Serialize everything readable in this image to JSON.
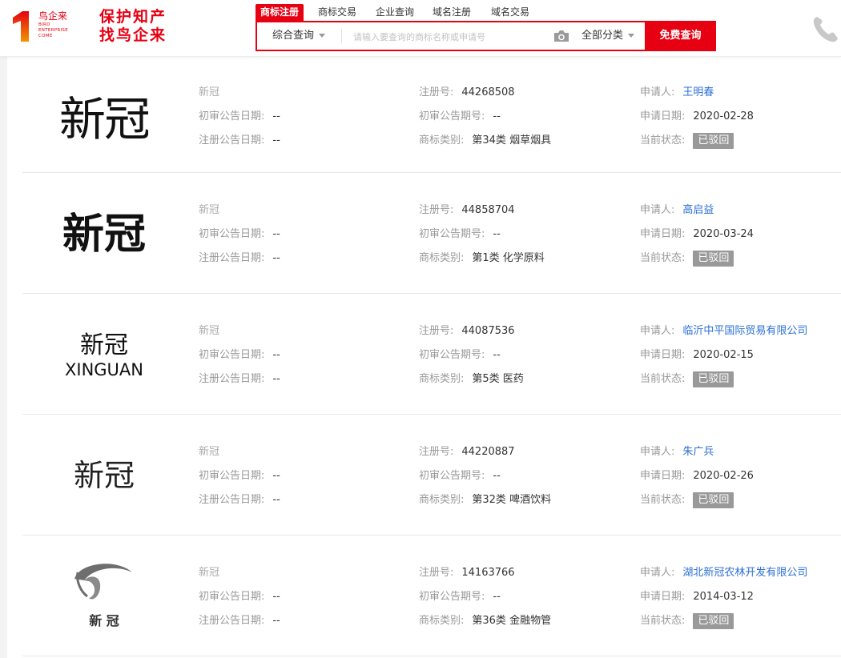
{
  "header": {
    "logo_cn": "鸟企来",
    "logo_en": [
      "BIRD",
      "ENTERPRISE",
      "COME"
    ],
    "slogan_line1": "保护知产",
    "slogan_line2": "找鸟企来",
    "tabs": [
      "商标注册",
      "商标交易",
      "企业查询",
      "域名注册",
      "域名交易"
    ],
    "search": {
      "mode": "综合查询",
      "placeholder": "请输入要查询的商标名称或申请号",
      "category": "全部分类",
      "button": "免费查询"
    }
  },
  "labels": {
    "reg_no": "注册号:",
    "applicant": "申请人:",
    "prelim_date": "初审公告日期:",
    "prelim_no": "初审公告期号:",
    "apply_date": "申请日期:",
    "reg_date": "注册公告日期:",
    "class": "商标类别:",
    "status": "当前状态:"
  },
  "results": [
    {
      "name": "新冠",
      "logo_text": "新冠",
      "reg_no": "44268508",
      "applicant": "王明春",
      "prelim_date": "--",
      "prelim_no": "--",
      "apply_date": "2020-02-28",
      "reg_date": "--",
      "class": "第34类 烟草烟具",
      "status": "已驳回"
    },
    {
      "name": "新冠",
      "logo_text": "新冠",
      "reg_no": "44858704",
      "applicant": "高启益",
      "prelim_date": "--",
      "prelim_no": "--",
      "apply_date": "2020-03-24",
      "reg_date": "--",
      "class": "第1类 化学原料",
      "status": "已驳回"
    },
    {
      "name": "新冠",
      "logo_text": "新冠",
      "logo_sub": "XINGUAN",
      "reg_no": "44087536",
      "applicant": "临沂中平国际贸易有限公司",
      "prelim_date": "--",
      "prelim_no": "--",
      "apply_date": "2020-02-15",
      "reg_date": "--",
      "class": "第5类 医药",
      "status": "已驳回"
    },
    {
      "name": "新冠",
      "logo_text": "新冠",
      "reg_no": "44220887",
      "applicant": "朱广兵",
      "prelim_date": "--",
      "prelim_no": "--",
      "apply_date": "2020-02-26",
      "reg_date": "--",
      "class": "第32类 啤酒饮料",
      "status": "已驳回"
    },
    {
      "name": "新冠",
      "logo_text": "新 冠",
      "reg_no": "14163766",
      "applicant": "湖北新冠农林开发有限公司",
      "prelim_date": "--",
      "prelim_no": "--",
      "apply_date": "2014-03-12",
      "reg_date": "--",
      "class": "第36类 金融物管",
      "status": "已驳回"
    }
  ]
}
